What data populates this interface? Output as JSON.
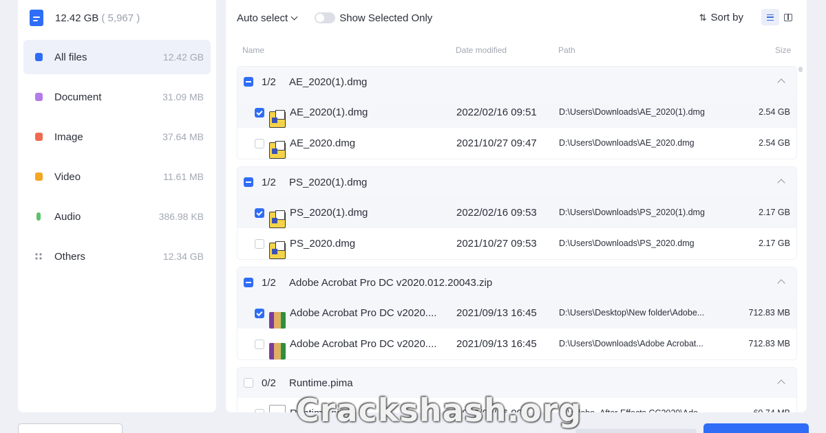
{
  "sidebar": {
    "total_size": "12.42 GB",
    "total_count": "( 5,967 )",
    "items": [
      {
        "label": "All files",
        "size": "12.42 GB",
        "icon": "folder-icon",
        "color": "#2f6df6"
      },
      {
        "label": "Document",
        "size": "31.09 MB",
        "icon": "document-icon",
        "color": "#b57be8"
      },
      {
        "label": "Image",
        "size": "37.64 MB",
        "icon": "image-icon",
        "color": "#f06a4f"
      },
      {
        "label": "Video",
        "size": "11.61 MB",
        "icon": "video-icon",
        "color": "#f5a623"
      },
      {
        "label": "Audio",
        "size": "386.98 KB",
        "icon": "audio-icon",
        "color": "#5cc26c"
      },
      {
        "label": "Others",
        "size": "12.34 GB",
        "icon": "others-icon",
        "color": "#8a8f99"
      }
    ]
  },
  "toolbar": {
    "auto_select": "Auto select",
    "show_selected_only": "Show Selected Only",
    "sort_by": "Sort by"
  },
  "columns": {
    "name": "Name",
    "date": "Date modified",
    "path": "Path",
    "size": "Size"
  },
  "groups": [
    {
      "count": "1/2",
      "name": "AE_2020(1).dmg",
      "rows": [
        {
          "name": "AE_2020(1).dmg",
          "date": "2022/02/16 09:51",
          "path": "D:\\Users\\Downloads\\AE_2020(1).dmg",
          "size": "2.54 GB",
          "checked": true,
          "icon": "dmg"
        },
        {
          "name": "AE_2020.dmg",
          "date": "2021/10/27 09:47",
          "path": "D:\\Users\\Downloads\\AE_2020.dmg",
          "size": "2.54 GB",
          "checked": false,
          "icon": "dmg"
        }
      ]
    },
    {
      "count": "1/2",
      "name": "PS_2020(1).dmg",
      "rows": [
        {
          "name": "PS_2020(1).dmg",
          "date": "2022/02/16 09:53",
          "path": "D:\\Users\\Downloads\\PS_2020(1).dmg",
          "size": "2.17 GB",
          "checked": true,
          "icon": "dmg"
        },
        {
          "name": "PS_2020.dmg",
          "date": "2021/10/27 09:53",
          "path": "D:\\Users\\Downloads\\PS_2020.dmg",
          "size": "2.17 GB",
          "checked": false,
          "icon": "dmg"
        }
      ]
    },
    {
      "count": "1/2",
      "name": "Adobe Acrobat Pro DC v2020.012.20043.zip",
      "rows": [
        {
          "name": "Adobe Acrobat Pro DC v2020....",
          "date": "2021/09/13 16:45",
          "path": "D:\\Users\\Desktop\\New folder\\Adobe...",
          "size": "712.83 MB",
          "checked": true,
          "icon": "zip"
        },
        {
          "name": "Adobe Acrobat Pro DC v2020....",
          "date": "2021/09/13 16:45",
          "path": "D:\\Users\\Downloads\\Adobe Acrobat...",
          "size": "712.83 MB",
          "checked": false,
          "icon": "zip"
        }
      ]
    },
    {
      "count": "0/2",
      "name": "Runtime.pima",
      "rows": [
        {
          "name": "Runtime.pima",
          "date": "2022/02/16 09:..",
          "path": "D:\\Adobe_After Effects CC2020\\Ado...",
          "size": "60.74 MB",
          "checked": false,
          "icon": "blank"
        }
      ]
    }
  ],
  "watermark": "Crackshash.org"
}
